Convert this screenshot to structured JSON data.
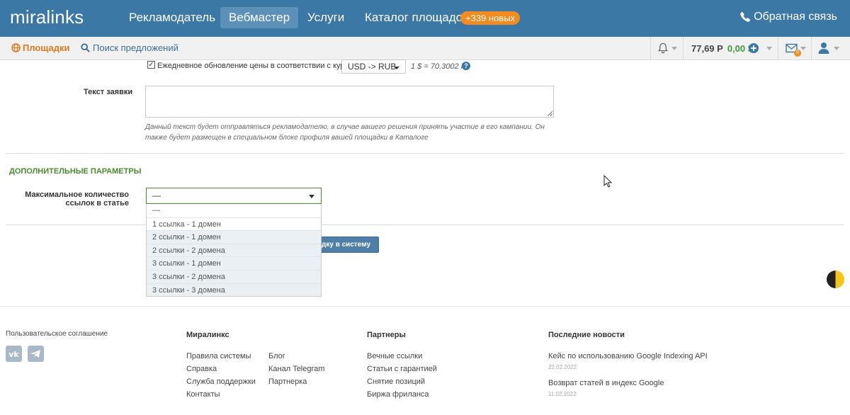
{
  "header": {
    "logo": "miralinks",
    "nav": [
      {
        "label": "Рекламодатель",
        "active": false
      },
      {
        "label": "Вебмастер",
        "active": true
      },
      {
        "label": "Услуги",
        "active": false
      },
      {
        "label": "Каталог площадок",
        "active": false
      }
    ],
    "new_badge": "+339 новых",
    "feedback": "Обратная связь"
  },
  "subbar": {
    "sites": "Площадки",
    "search": "Поиск предложений",
    "balance_rub": "77,69 Р",
    "balance_usd": "0,00 $",
    "mail_count": "9"
  },
  "form": {
    "daily_update_label": "Ежедневное обновление цены в соответствии с курсом",
    "daily_update_checked": true,
    "currency_value": "USD -> RUB",
    "rate_text": "1 $ = 70.3002 Р",
    "help": "?",
    "request_label": "Текст заявки",
    "request_value": "",
    "request_help": "Данный текст будет отправляться рекламодателю, в случае вашего решения принять участие в его кампании. Он также будет размещен в специальном блоке профиля вашей площадки в Каталоге",
    "extra_title": "Дополнительные параметры",
    "max_links_label": "Максимальное количество ссылок в статье",
    "max_links_value": "—",
    "max_links_options": [
      "—",
      "1 ссылка - 1 домен",
      "2 ссылки - 1 домен",
      "2 ссылки - 2 домена",
      "3 ссылки - 1 домен",
      "3 ссылки - 2 домена",
      "3 ссылки - 3 домена"
    ],
    "submit": "дку в систему"
  },
  "footer": {
    "agreement": "Пользовательское соглашение",
    "col1_title": "Миралинкс",
    "col1_links": [
      "Правила системы",
      "Справка",
      "Служба поддержки",
      "Контакты"
    ],
    "col1b_links": [
      "Блог",
      "Канал Telegram",
      "Партнерка"
    ],
    "col2_title": "Партнеры",
    "col2_links": [
      "Вечные ссылки",
      "Статьи с гарантией",
      "Снятие позиций",
      "Биржа фриланса"
    ],
    "col3_title": "Последние новости",
    "news": [
      {
        "title": "Кейс по использованию Google Indexing API",
        "date": "22.02.2022"
      },
      {
        "title": "Возврат статей в индекс Google",
        "date": "11.02.2022"
      }
    ]
  },
  "colors": {
    "brand": "#3c78a5",
    "accent": "#f58a1f",
    "green": "#4b8a31"
  }
}
